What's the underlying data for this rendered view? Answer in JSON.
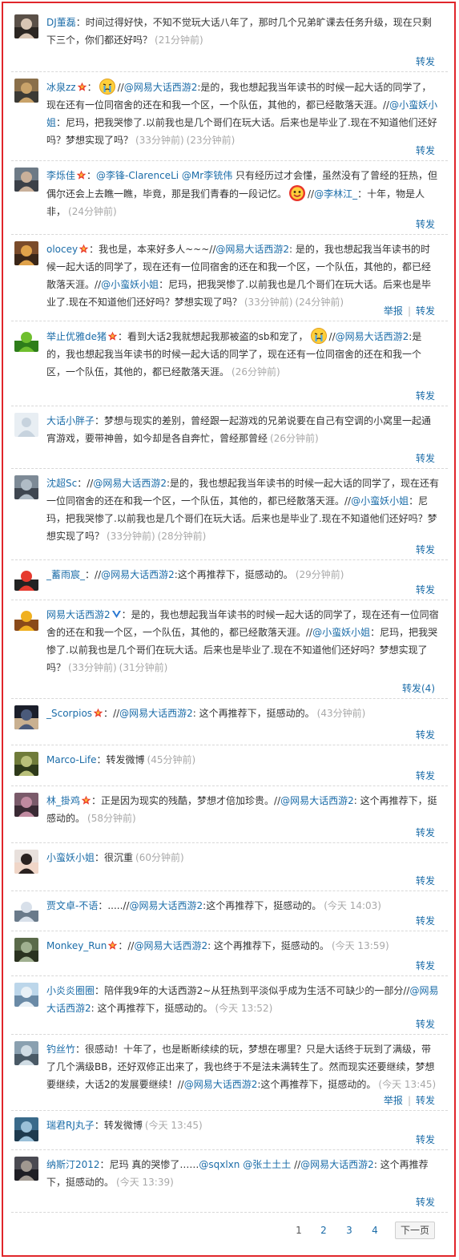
{
  "colors": {
    "border": "#e0262b",
    "link": "#1b6ca8",
    "muted": "#a8a8a8"
  },
  "items": [
    {
      "user": "DJ董磊",
      "badge": false,
      "avatar": "boy-photo-avatar",
      "parts": [
        {
          "t": "text",
          "v": "时间过得好快，不知不觉玩大话八年了，那时几个兄弟旷课去任务升级，现在只剩下三个，你们都还好吗？"
        },
        {
          "t": "time",
          "v": "(21分钟前)"
        }
      ],
      "actions": [
        "转发"
      ]
    },
    {
      "user": "冰泉zz",
      "badge": true,
      "avatar": "scene-photo-avatar",
      "parts": [
        {
          "t": "emoji",
          "v": "crying-emoji"
        },
        {
          "t": "sep",
          "v": "//"
        },
        {
          "t": "link",
          "v": "@网易大话西游2"
        },
        {
          "t": "text",
          "v": ":是的，我也想起我当年读书的时候一起大话的同学了，现在还有一位同宿舍的还在和我一个区，一个队伍，其他的，都已经散落天涯。"
        },
        {
          "t": "sep",
          "v": "//"
        },
        {
          "t": "link",
          "v": "@小蛮妖小姐"
        },
        {
          "t": "text",
          "v": "：尼玛，把我哭惨了.以前我也是几个哥们在玩大话。后来也是毕业了.现在不知道他们还好吗？梦想实现了吗？"
        },
        {
          "t": "time",
          "v": "(33分钟前)"
        },
        {
          "t": "time",
          "v": "(23分钟前)"
        }
      ],
      "actions": [
        "转发"
      ]
    },
    {
      "user": "李烁佳",
      "badge": true,
      "avatar": "man-photo-avatar",
      "parts": [
        {
          "t": "link",
          "v": "@李锋-ClarenceLi"
        },
        {
          "t": "text",
          "v": " "
        },
        {
          "t": "link",
          "v": "@Mr李铳伟"
        },
        {
          "t": "text",
          "v": " 只有经历过才会懂，虽然没有了曾经的狂热，但偶尔还会上去瞧一瞧，毕竟，那是我们青春的一段记忆。"
        },
        {
          "t": "emoji",
          "v": "smile-emoji"
        },
        {
          "t": "sep",
          "v": "//"
        },
        {
          "t": "link",
          "v": "@李林江_"
        },
        {
          "t": "text",
          "v": "：十年，物是人非，"
        },
        {
          "t": "time",
          "v": "(24分钟前)"
        }
      ],
      "actions": [
        "转发"
      ]
    },
    {
      "user": "olocey",
      "badge": true,
      "avatar": "warrior-avatar",
      "parts": [
        {
          "t": "text",
          "v": "我也是，本来好多人~~~"
        },
        {
          "t": "sep",
          "v": "//"
        },
        {
          "t": "link",
          "v": "@网易大话西游2"
        },
        {
          "t": "text",
          "v": ": 是的，我也想起我当年读书的时候一起大话的同学了，现在还有一位同宿舍的还在和我一个区，一个队伍，其他的，都已经散落天涯。"
        },
        {
          "t": "sep",
          "v": "//"
        },
        {
          "t": "link",
          "v": "@小蛮妖小姐"
        },
        {
          "t": "text",
          "v": "：尼玛，把我哭惨了.以前我也是几个哥们在玩大话。后来也是毕业了.现在不知道他们还好吗？梦想实现了吗？"
        },
        {
          "t": "time",
          "v": "(33分钟前)"
        },
        {
          "t": "time",
          "v": "(24分钟前)"
        }
      ],
      "actions": [
        "举报",
        "转发"
      ]
    },
    {
      "user": "举止优雅de猪",
      "badge": true,
      "avatar": "green-creature-avatar",
      "parts": [
        {
          "t": "text",
          "v": "看到大话2我就想起我那被盗的sb和宠了，"
        },
        {
          "t": "emoji",
          "v": "crying-emoji"
        },
        {
          "t": "sep",
          "v": "//"
        },
        {
          "t": "link",
          "v": "@网易大话西游2"
        },
        {
          "t": "text",
          "v": ":是的，我也想起我当年读书的时候一起大话的同学了，现在还有一位同宿舍的还在和我一个区，一个队伍，其他的，都已经散落天涯。"
        },
        {
          "t": "time",
          "v": "(26分钟前)"
        }
      ],
      "actions": [
        "转发"
      ]
    },
    {
      "user": "大话小胖子",
      "badge": false,
      "avatar": "default-avatar",
      "parts": [
        {
          "t": "text",
          "v": "梦想与现实的差别，曾经跟一起游戏的兄弟说要在自己有空调的小窝里一起通宵游戏，要带神兽，如今却是各自奔忙，曾经那曾经"
        },
        {
          "t": "time",
          "v": "(26分钟前)"
        }
      ],
      "actions": [
        "转发"
      ]
    },
    {
      "user": "沈超Sc",
      "badge": false,
      "avatar": "city-photo-avatar",
      "parts": [
        {
          "t": "sep",
          "v": "//"
        },
        {
          "t": "link",
          "v": "@网易大话西游2"
        },
        {
          "t": "text",
          "v": ":是的，我也想起我当年读书的时候一起大话的同学了，现在还有一位同宿舍的还在和我一个区，一个队伍，其他的，都已经散落天涯。"
        },
        {
          "t": "sep",
          "v": "//"
        },
        {
          "t": "link",
          "v": "@小蛮妖小姐"
        },
        {
          "t": "text",
          "v": "：尼玛，把我哭惨了.以前我也是几个哥们在玩大话。后来也是毕业了.现在不知道他们还好吗？梦想实现了吗？"
        },
        {
          "t": "time",
          "v": "(33分钟前)"
        },
        {
          "t": "time",
          "v": "(28分钟前)"
        }
      ],
      "actions": [
        "转发"
      ]
    },
    {
      "user": "_蓄雨宸_",
      "badge": false,
      "avatar": "red-cartoon-avatar",
      "parts": [
        {
          "t": "sep",
          "v": "//"
        },
        {
          "t": "link",
          "v": "@网易大话西游2"
        },
        {
          "t": "text",
          "v": ":这个再推荐下，挺感动的。"
        },
        {
          "t": "time",
          "v": "(29分钟前)"
        }
      ],
      "actions": [
        "转发"
      ]
    },
    {
      "user": "网易大话西游2",
      "badge": false,
      "verified": true,
      "avatar": "game-character-avatar",
      "parts": [
        {
          "t": "text",
          "v": "是的，我也想起我当年读书的时候一起大话的同学了，现在还有一位同宿舍的还在和我一个区，一个队伍，其他的，都已经散落天涯。"
        },
        {
          "t": "sep",
          "v": "//"
        },
        {
          "t": "link",
          "v": "@小蛮妖小姐"
        },
        {
          "t": "text",
          "v": "：尼玛，把我哭惨了.以前我也是几个哥们在玩大话。后来也是毕业了.现在不知道他们还好吗？梦想实现了吗？"
        },
        {
          "t": "time",
          "v": "(33分钟前)"
        },
        {
          "t": "time",
          "v": "(31分钟前)"
        }
      ],
      "actions": [
        "转发(4)"
      ]
    },
    {
      "user": "_Scorpios",
      "badge": true,
      "avatar": "dark-photo-avatar",
      "parts": [
        {
          "t": "sep",
          "v": "//"
        },
        {
          "t": "link",
          "v": "@网易大话西游2"
        },
        {
          "t": "text",
          "v": ": 这个再推荐下，挺感动的。"
        },
        {
          "t": "time",
          "v": "(43分钟前)"
        }
      ],
      "actions": [
        "转发"
      ]
    },
    {
      "user": "Marco-Life",
      "badge": false,
      "avatar": "person-photo-avatar",
      "parts": [
        {
          "t": "text",
          "v": "转发微博"
        },
        {
          "t": "time",
          "v": "(45分钟前)"
        }
      ],
      "actions": [
        "转发"
      ]
    },
    {
      "user": "林_掛鸡",
      "badge": true,
      "avatar": "landscape-photo-avatar",
      "parts": [
        {
          "t": "text",
          "v": "正是因为现实的残酷，梦想才倍加珍贵。"
        },
        {
          "t": "sep",
          "v": "//"
        },
        {
          "t": "link",
          "v": "@网易大话西游2"
        },
        {
          "t": "text",
          "v": ": 这个再推荐下，挺感动的。"
        },
        {
          "t": "time",
          "v": "(58分钟前)"
        }
      ],
      "actions": [
        "转发"
      ]
    },
    {
      "user": "小蛮妖小姐",
      "badge": false,
      "avatar": "girl-photo-avatar",
      "parts": [
        {
          "t": "text",
          "v": "很沉重"
        },
        {
          "t": "time",
          "v": "(60分钟前)"
        }
      ],
      "actions": [
        "转发"
      ]
    },
    {
      "user": "贾文卓-不语",
      "badge": false,
      "avatar": "white-cartoon-avatar",
      "parts": [
        {
          "t": "text",
          "v": "....."
        },
        {
          "t": "sep",
          "v": "//"
        },
        {
          "t": "link",
          "v": "@网易大话西游2"
        },
        {
          "t": "text",
          "v": ":这个再推荐下，挺感动的。"
        },
        {
          "t": "time",
          "v": "(今天 14:03)"
        }
      ],
      "actions": [
        "转发"
      ]
    },
    {
      "user": "Monkey_Run",
      "badge": true,
      "avatar": "outdoor-photo-avatar",
      "parts": [
        {
          "t": "sep",
          "v": "//"
        },
        {
          "t": "link",
          "v": "@网易大话西游2"
        },
        {
          "t": "text",
          "v": ": 这个再推荐下，挺感动的。"
        },
        {
          "t": "time",
          "v": "(今天 13:59)"
        }
      ],
      "actions": [
        "转发"
      ]
    },
    {
      "user": "小炎炎圈圈",
      "badge": false,
      "avatar": "sky-photo-avatar",
      "parts": [
        {
          "t": "text",
          "v": "陪伴我9年的大话西游2~从狂热到平淡似乎成为生活不可缺少的一部分"
        },
        {
          "t": "sep",
          "v": "//"
        },
        {
          "t": "link",
          "v": "@网易大话西游2"
        },
        {
          "t": "text",
          "v": ": 这个再推荐下，挺感动的。"
        },
        {
          "t": "time",
          "v": "(今天 13:52)"
        }
      ],
      "actions": [
        "转发"
      ]
    },
    {
      "user": "钓丝竹",
      "badge": false,
      "avatar": "cloud-photo-avatar",
      "parts": [
        {
          "t": "text",
          "v": "很感动！十年了，也是断断续续的玩，梦想在哪里？只是大话终于玩到了满级，带了几个满级BB，还好双修正出来了，我也终于不是法未满转生了。然而现实还要继续，梦想要继续，大话2的发展要继续！"
        },
        {
          "t": "sep",
          "v": "//"
        },
        {
          "t": "link",
          "v": "@网易大话西游2"
        },
        {
          "t": "text",
          "v": ":这个再推荐下，挺感动的。"
        },
        {
          "t": "time",
          "v": "(今天 13:45)"
        }
      ],
      "actions": [
        "举报",
        "转发"
      ]
    },
    {
      "user": "瑞君RJ丸子",
      "badge": false,
      "avatar": "sea-photo-avatar",
      "parts": [
        {
          "t": "text",
          "v": "转发微博"
        },
        {
          "t": "time",
          "v": "(今天 13:45)"
        }
      ],
      "actions": [
        "转发"
      ]
    },
    {
      "user": "纳斯汀2012",
      "badge": false,
      "avatar": "group-photo-avatar",
      "parts": [
        {
          "t": "text",
          "v": "尼玛 真的哭惨了……"
        },
        {
          "t": "link",
          "v": "@sqxlxn"
        },
        {
          "t": "text",
          "v": " "
        },
        {
          "t": "link",
          "v": "@张土土土"
        },
        {
          "t": "text",
          "v": " "
        },
        {
          "t": "sep",
          "v": "//"
        },
        {
          "t": "link",
          "v": "@网易大话西游2"
        },
        {
          "t": "text",
          "v": ": 这个再推荐下，挺感动的。"
        },
        {
          "t": "time",
          "v": "(今天 13:39)"
        }
      ],
      "actions": [
        "转发"
      ]
    }
  ],
  "pager": {
    "pages": [
      "1",
      "2",
      "3",
      "4"
    ],
    "current": "1",
    "next": "下一页"
  }
}
